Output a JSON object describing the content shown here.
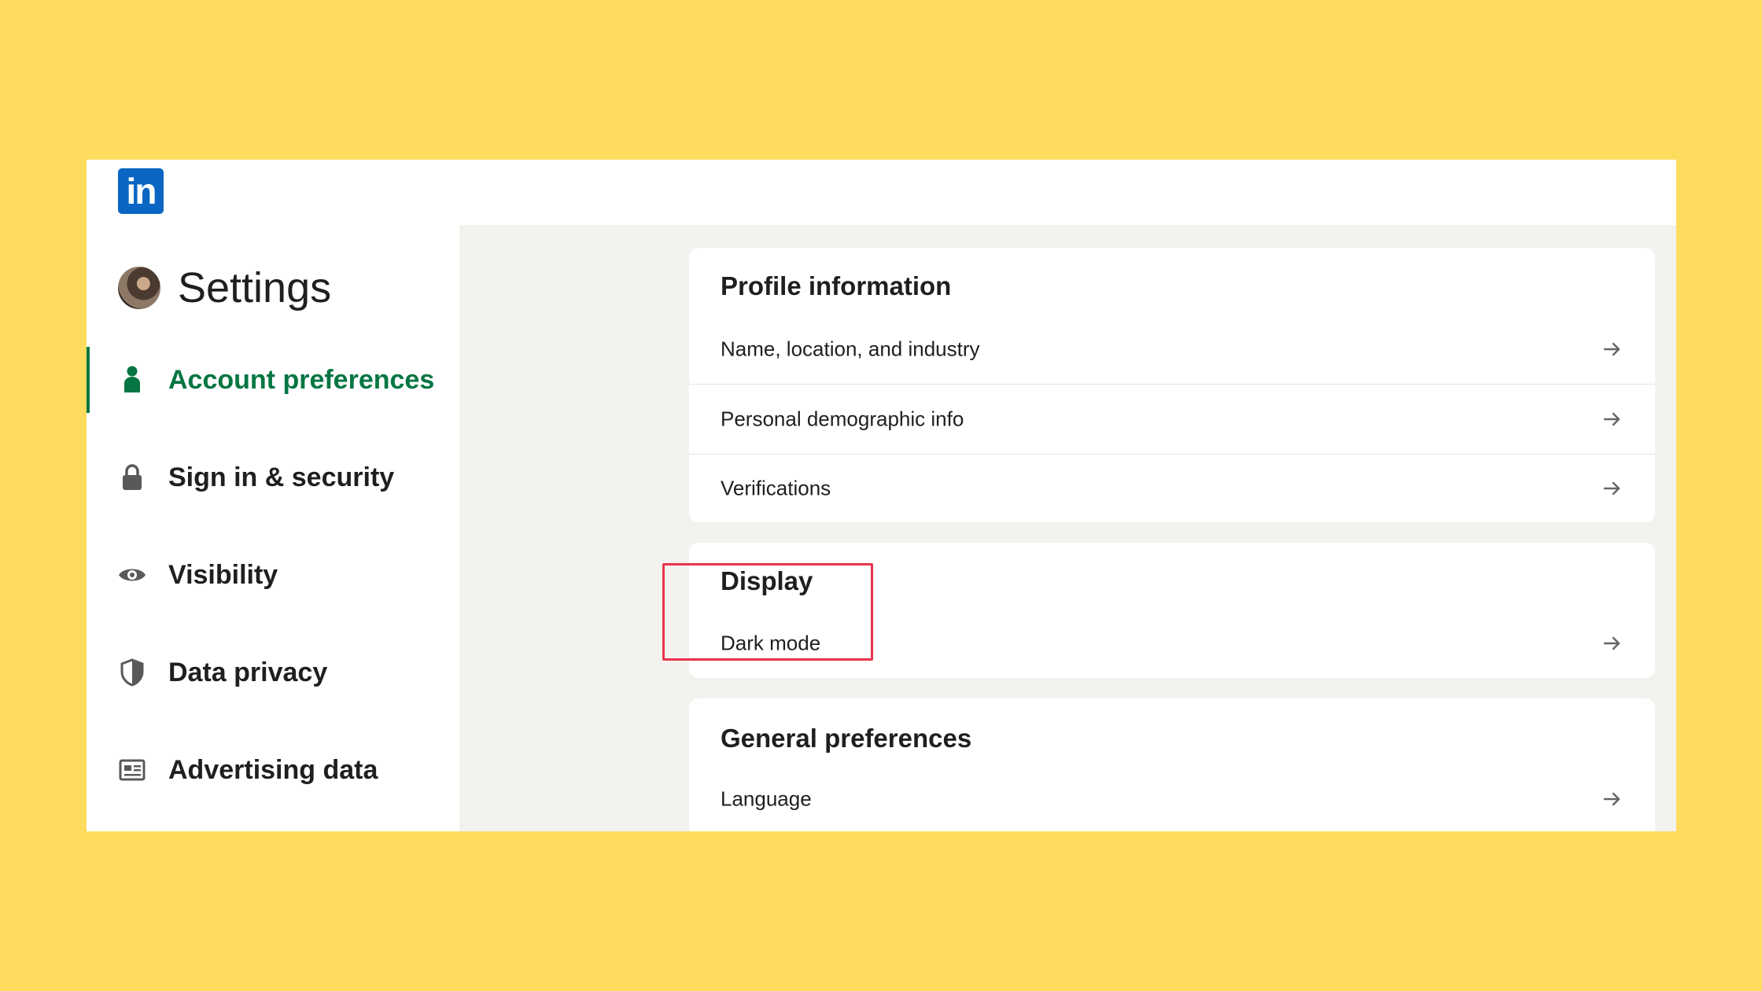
{
  "brand": {
    "logo_text": "in",
    "color": "#0A66C2"
  },
  "sidebar": {
    "title": "Settings",
    "accent_color": "#057642",
    "items": [
      {
        "label": "Account preferences",
        "icon": "person-icon",
        "active": true
      },
      {
        "label": "Sign in & security",
        "icon": "lock-icon",
        "active": false
      },
      {
        "label": "Visibility",
        "icon": "eye-icon",
        "active": false
      },
      {
        "label": "Data privacy",
        "icon": "shield-icon",
        "active": false
      },
      {
        "label": "Advertising data",
        "icon": "newspaper-icon",
        "active": false
      }
    ]
  },
  "main": {
    "sections": [
      {
        "title": "Profile information",
        "rows": [
          "Name, location, and industry",
          "Personal demographic info",
          "Verifications"
        ]
      },
      {
        "title": "Display",
        "rows": [
          "Dark mode"
        ]
      },
      {
        "title": "General preferences",
        "rows": [
          "Language"
        ]
      }
    ]
  },
  "annotation": {
    "color": "#E8344E",
    "target": "Display"
  }
}
